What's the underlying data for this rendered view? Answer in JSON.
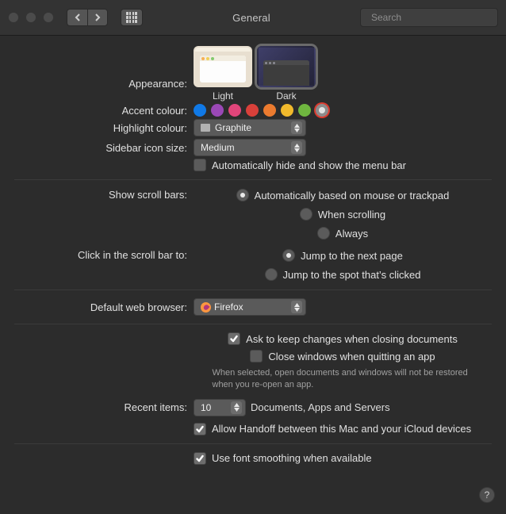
{
  "window": {
    "title": "General",
    "search_placeholder": "Search"
  },
  "appearance": {
    "label": "Appearance:",
    "options": [
      "Light",
      "Dark"
    ],
    "selected": "Dark"
  },
  "accent": {
    "label": "Accent colour:",
    "colours": [
      "#1079e6",
      "#9a48b6",
      "#e0457a",
      "#d9403a",
      "#ec7b2f",
      "#f1b92c",
      "#6fb63f",
      "#8c8c8c"
    ],
    "selected_index": 7
  },
  "highlight": {
    "label": "Highlight colour:",
    "value": "Graphite"
  },
  "sidebar_icon": {
    "label": "Sidebar icon size:",
    "value": "Medium"
  },
  "menubar": {
    "auto_hide": "Automatically hide and show the menu bar",
    "auto_hide_checked": false
  },
  "scrollbars": {
    "show_label": "Show scroll bars:",
    "show_options": [
      "Automatically based on mouse or trackpad",
      "When scrolling",
      "Always"
    ],
    "show_selected": 0,
    "click_label": "Click in the scroll bar to:",
    "click_options": [
      "Jump to the next page",
      "Jump to the spot that’s clicked"
    ],
    "click_selected": 0
  },
  "browser": {
    "label": "Default web browser:",
    "value": "Firefox"
  },
  "documents": {
    "ask_keep": "Ask to keep changes when closing documents",
    "ask_keep_checked": true,
    "close_windows": "Close windows when quitting an app",
    "close_windows_checked": false,
    "close_windows_hint": "When selected, open documents and windows will not be restored when you re-open an app."
  },
  "recent": {
    "label": "Recent items:",
    "value": "10",
    "suffix": "Documents, Apps and Servers"
  },
  "handoff": {
    "label": "Allow Handoff between this Mac and your iCloud devices",
    "checked": true
  },
  "font_smoothing": {
    "label": "Use font smoothing when available",
    "checked": true
  }
}
